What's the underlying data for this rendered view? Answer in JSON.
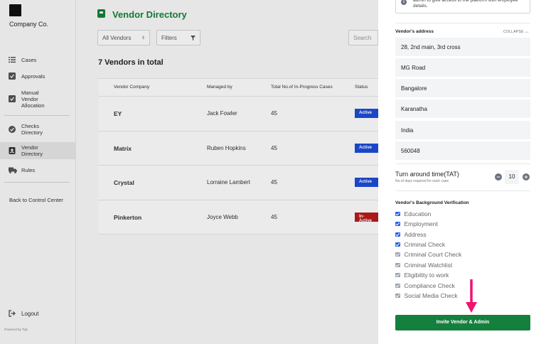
{
  "sidebar": {
    "company": "Company Co.",
    "items": [
      {
        "label": "Cases",
        "icon": "list-icon"
      },
      {
        "label": "Approvals",
        "icon": "check-square-icon"
      },
      {
        "label": "Manual Vendor Allocation",
        "icon": "check-square-icon"
      },
      {
        "label": "Checks Directory",
        "icon": "check-circle-icon"
      },
      {
        "label": "Vendor Directory",
        "icon": "contact-icon"
      },
      {
        "label": "Rules",
        "icon": "truck-icon"
      }
    ],
    "back_link": "Back to Control Center",
    "logout": "Logout",
    "powered_by": "Powered by Tyly"
  },
  "main": {
    "title": "Vendor Directory",
    "vendor_filter": "All Vendors",
    "filters_label": "Filters",
    "search_placeholder": "Search",
    "count_title": "7 Vendors in total",
    "columns": [
      "Vendor Company",
      "Managed by",
      "Total No.of In-Progress Cases",
      "Status"
    ],
    "rows": [
      {
        "company": "EY",
        "manager": "Jack Fowler",
        "cases": "45",
        "status": "Active"
      },
      {
        "company": "Matrix",
        "manager": "Ruben Hopkins",
        "cases": "45",
        "status": "Active"
      },
      {
        "company": "Crystal",
        "manager": "Lorraine Lambert",
        "cases": "45",
        "status": "Active"
      },
      {
        "company": "Pinkerton",
        "manager": "Joyce Webb",
        "cases": "45",
        "status": "In-Active"
      }
    ]
  },
  "panel": {
    "info_text": "admin to give access to the platform with employee details.",
    "address_label": "Vendor's address",
    "collapse_label": "COLLAPSE",
    "address_lines": [
      "28, 2nd main, 3rd cross",
      "MG Road",
      "Bangalore",
      "Karanatha",
      "India",
      "560048"
    ],
    "tat_label": "Turn around time(TAT)",
    "tat_sub": "No.of days required for each case",
    "tat_value": "10",
    "bgv_label": "Vendor's Background Verification",
    "checks": [
      {
        "label": "Education",
        "checked": true
      },
      {
        "label": "Employment",
        "checked": true
      },
      {
        "label": "Address",
        "checked": true
      },
      {
        "label": "Criminal Check",
        "checked": true
      },
      {
        "label": "Criminal Court Check",
        "checked": false
      },
      {
        "label": "Criminal Watchlist",
        "checked": false
      },
      {
        "label": "Eligibility to work",
        "checked": false
      },
      {
        "label": "Compliance Check",
        "checked": false
      },
      {
        "label": "Social Media Check",
        "checked": false
      }
    ],
    "invite_button": "Invite Vendor & Admin"
  },
  "colors": {
    "brand_green": "#15803d",
    "active_blue": "#1d4ed8",
    "inactive_red": "#b91c1c",
    "arrow_pink": "#f0146e"
  }
}
